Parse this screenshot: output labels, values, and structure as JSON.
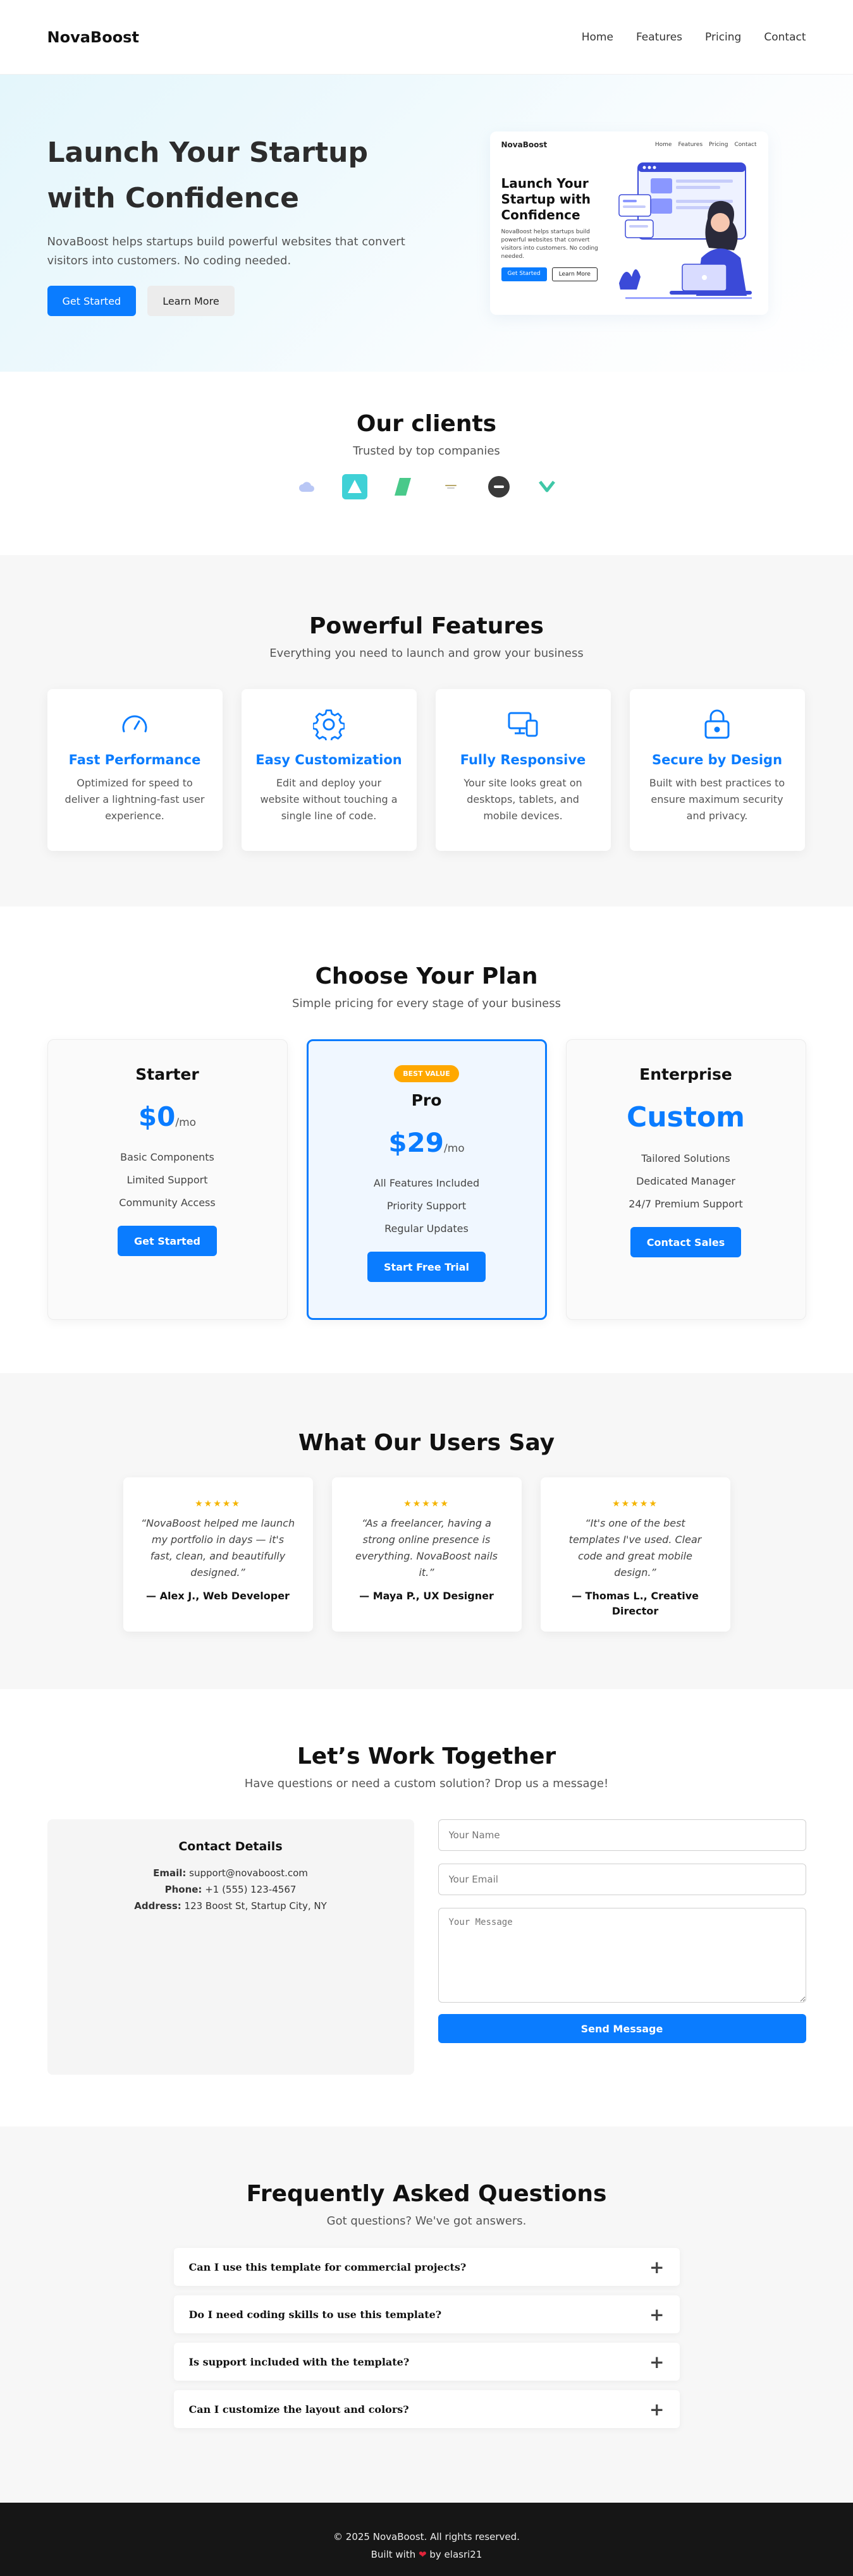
{
  "nav": {
    "brand": "NovaBoost",
    "links": [
      "Home",
      "Features",
      "Pricing",
      "Contact"
    ]
  },
  "hero": {
    "title": "Launch Your Startup with Confidence",
    "subtitle": "NovaBoost helps startups build powerful websites that convert visitors into customers. No coding needed.",
    "primary_button": "Get Started",
    "secondary_button": "Learn More",
    "illustration": {
      "brand": "NovaBoost",
      "links": [
        "Home",
        "Features",
        "Pricing",
        "Contact"
      ],
      "title": "Launch Your Startup with Confidence",
      "subtitle": "NovaBoost helps startups build powerful websites that convert visitors into customers. No coding needed.",
      "primary_button": "Get Started",
      "secondary_button": "Learn More"
    }
  },
  "clients": {
    "title": "Our clients",
    "subtitle": "Trusted by top companies"
  },
  "features": {
    "title": "Powerful Features",
    "subtitle": "Everything you need to launch and grow your business",
    "items": [
      {
        "icon": "speedometer-icon",
        "title": "Fast Performance",
        "desc": "Optimized for speed to deliver a lightning-fast user experience."
      },
      {
        "icon": "gear-icon",
        "title": "Easy Customization",
        "desc": "Edit and deploy your website without touching a single line of code."
      },
      {
        "icon": "devices-icon",
        "title": "Fully Responsive",
        "desc": "Your site looks great on desktops, tablets, and mobile devices."
      },
      {
        "icon": "lock-icon",
        "title": "Secure by Design",
        "desc": "Built with best practices to ensure maximum security and privacy."
      }
    ]
  },
  "pricing": {
    "title": "Choose Your Plan",
    "subtitle": "Simple pricing for every stage of your business",
    "plans": [
      {
        "name": "Starter",
        "price": "$0",
        "unit": "/mo",
        "features": [
          "Basic Components",
          "Limited Support",
          "Community Access"
        ],
        "button": "Get Started"
      },
      {
        "badge": "BEST VALUE",
        "name": "Pro",
        "price": "$29",
        "unit": "/mo",
        "features": [
          "All Features Included",
          "Priority Support",
          "Regular Updates"
        ],
        "button": "Start Free Trial"
      },
      {
        "name": "Enterprise",
        "price": "Custom",
        "features": [
          "Tailored Solutions",
          "Dedicated Manager",
          "24/7 Premium Support"
        ],
        "button": "Contact Sales"
      }
    ]
  },
  "testimonials": {
    "title": "What Our Users Say",
    "stars": "★★★★★",
    "items": [
      {
        "quote": "“NovaBoost helped me launch my portfolio in days — it's fast, clean, and beautifully designed.”",
        "author": "— Alex J., Web Developer"
      },
      {
        "quote": "“As a freelancer, having a strong online presence is everything. NovaBoost nails it.”",
        "author": "— Maya P., UX Designer"
      },
      {
        "quote": "“It's one of the best templates I've used. Clear code and great mobile design.”",
        "author": "— Thomas L., Creative Director"
      }
    ]
  },
  "contact": {
    "title": "Let’s Work Together",
    "subtitle": "Have questions or need a custom solution? Drop us a message!",
    "details_title": "Contact Details",
    "email_label": "Email:",
    "email": "support@novaboost.com",
    "phone_label": "Phone:",
    "phone": "+1 (555) 123-4567",
    "address_label": "Address:",
    "address": "123 Boost St, Startup City, NY",
    "name_placeholder": "Your Name",
    "email_placeholder": "Your Email",
    "message_placeholder": "Your Message",
    "submit": "Send Message"
  },
  "faq": {
    "title": "Frequently Asked Questions",
    "subtitle": "Got questions? We've got answers.",
    "items": [
      "Can I use this template for commercial projects?",
      "Do I need coding skills to use this template?",
      "Is support included with the template?",
      "Can I customize the layout and colors?"
    ]
  },
  "footer": {
    "copyright": "© 2025 NovaBoost. All rights reserved.",
    "built_with": "Built with",
    "heart": "❤",
    "by": "by elasri21"
  },
  "colors": {
    "accent": "#0a7cff",
    "badge": "#ffa800",
    "star": "#f4b400",
    "footer_bg": "#161616"
  }
}
